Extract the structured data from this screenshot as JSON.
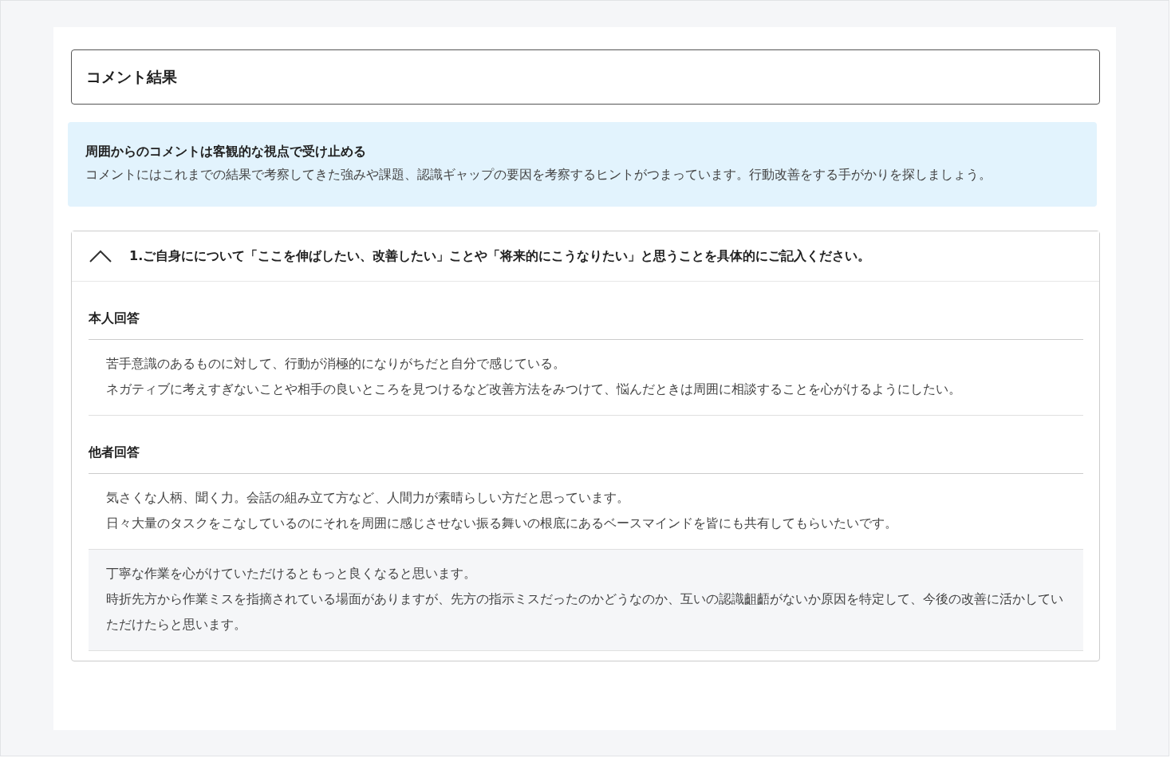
{
  "title": "コメント結果",
  "notice": {
    "heading": "周囲からのコメントは客観的な視点で受け止める",
    "body": "コメントにはこれまでの結果で考察してきた強みや課題、認識ギャップの要因を考察するヒントがつまっています。行動改善をする手がかりを探しましょう。"
  },
  "questions": [
    {
      "question": "1.ご自身にについて「ここを伸ばしたい、改善したい」ことや「将来的にこうなりたい」と思うことを具体的にご記入ください。",
      "expanded": true,
      "sections": [
        {
          "heading": "本人回答",
          "answers": [
            {
              "lines": [
                "苦手意識のあるものに対して、行動が消極的になりがちだと自分で感じている。",
                "ネガティブに考えすぎないことや相手の良いところを見つけるなど改善方法をみつけて、悩んだときは周囲に相談することを心がけるようにしたい。"
              ]
            }
          ]
        },
        {
          "heading": "他者回答",
          "answers": [
            {
              "lines": [
                "気さくな人柄、聞く力。会話の組み立て方など、人間力が素晴らしい方だと思っています。",
                "日々大量のタスクをこなしているのにそれを周囲に感じさせない振る舞いの根底にあるベースマインドを皆にも共有してもらいたいです。"
              ]
            },
            {
              "lines": [
                "丁寧な作業を心がけていただけるともっと良くなると思います。",
                "時折先方から作業ミスを指摘されている場面がありますが、先方の指示ミスだったのかどうなのか、互いの認識齟齬がないか原因を特定して、今後の改善に活かしていただけたらと思います。"
              ]
            }
          ]
        }
      ]
    }
  ]
}
